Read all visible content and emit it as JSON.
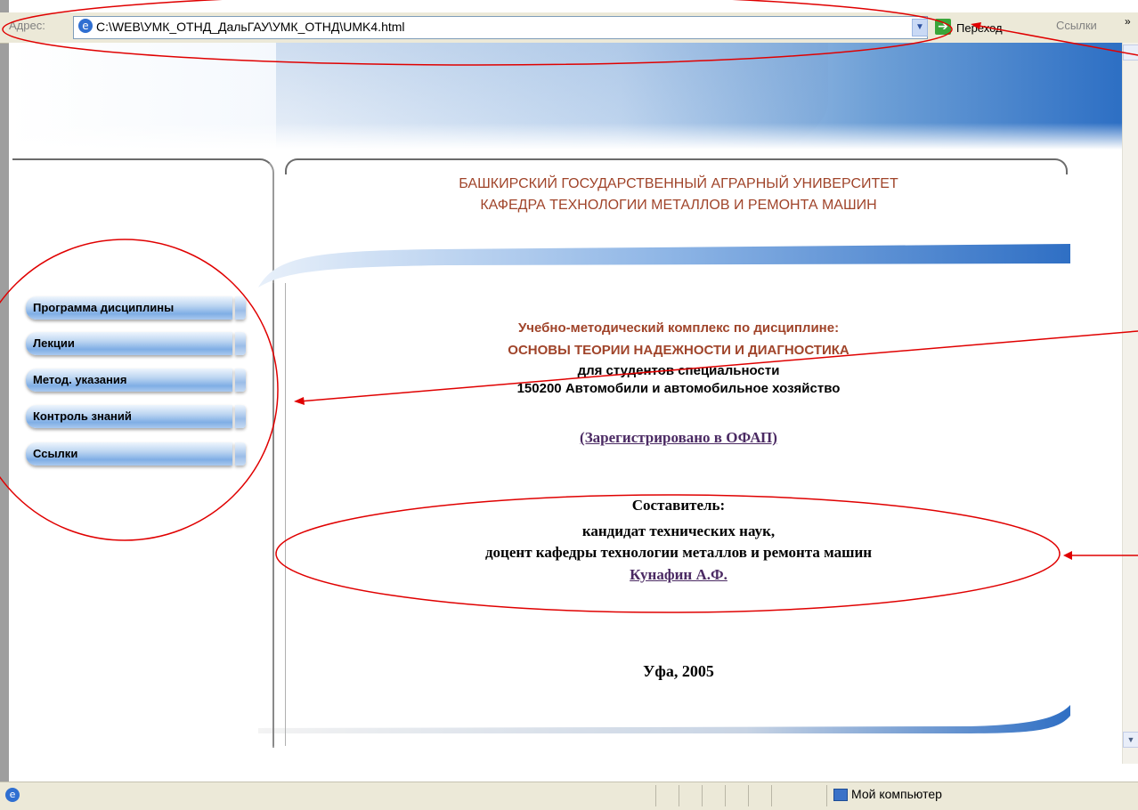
{
  "browser": {
    "address_label": "Адрес:",
    "url": "C:\\WEB\\УМК_ОТНД_ДальГАУ\\УМК_ОТНД\\UMK4.html",
    "go_label": "Переход",
    "links_label": "Ссылки",
    "more_label": "»"
  },
  "header": {
    "university": "БАШКИРСКИЙ ГОСУДАРСТВЕННЫЙ АГРАРНЫЙ УНИВЕРСИТЕТ",
    "department": "КАФЕДРА ТЕХНОЛОГИИ МЕТАЛЛОВ И РЕМОНТА МАШИН"
  },
  "nav": {
    "items": [
      {
        "label": "Программа дисциплины"
      },
      {
        "label": "Лекции"
      },
      {
        "label": "Метод. указания"
      },
      {
        "label": "Контроль знаний"
      },
      {
        "label": "Ссылки"
      }
    ]
  },
  "content": {
    "course_title": "Учебно-методический комплекс по дисциплине:",
    "discipline": "ОСНОВЫ ТЕОРИИ НАДЕЖНОСТИ И ДИАГНОСТИКА",
    "students": "для студентов специальности",
    "specialty": "150200 Автомобили и автомобильное хозяйство",
    "registration_link": "(Зарегистрировано в ОФАП)",
    "composer_label": "Составитель:",
    "degree": "кандидат технических наук,",
    "position": "доцент кафедры технологии металлов и ремонта машин",
    "author": "Кунафин А.Ф.",
    "city_year": "Уфа, 2005"
  },
  "status": {
    "zone": "Мой компьютер"
  },
  "colors": {
    "header_text": "#a0442a",
    "link_text": "#4b2a63",
    "annotation": "#e00000"
  }
}
